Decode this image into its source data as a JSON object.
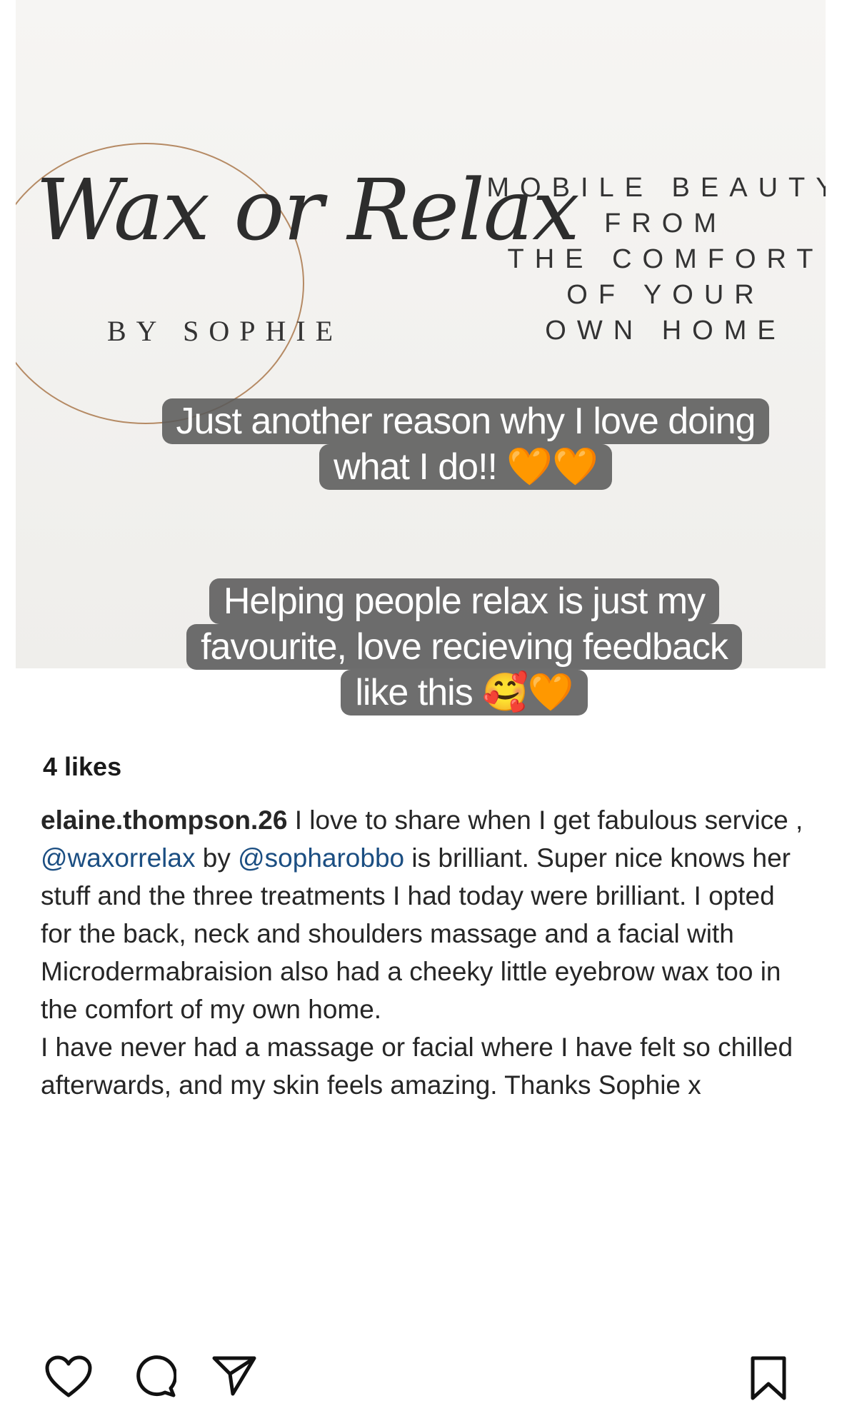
{
  "post_image": {
    "logo": {
      "script": "Wax or Relax",
      "by_line": "BY SOPHIE"
    },
    "tagline": "MOBILE BEAUTY\nFROM\nTHE COMFORT\nOF YOUR\nOWN HOME",
    "story_text_1": [
      "Just another reason why I love doing",
      "what I do!! 🧡🧡"
    ],
    "story_text_2": [
      "Helping people relax is just my",
      "favourite, love recieving feedback",
      "like this 🥰🧡"
    ]
  },
  "actions": {
    "like_icon": "heart-outline-icon",
    "comment_icon": "comment-bubble-icon",
    "share_icon": "paper-plane-icon",
    "save_icon": "bookmark-icon"
  },
  "likes": "4 likes",
  "caption": {
    "username": "elaine.thompson.26",
    "part1": " I love to share when I get fabulous service , ",
    "mention1": "@waxorrelax",
    "part2": " by ",
    "mention2": "@sopharobbo",
    "part3": " is brilliant. Super nice knows her stuff and the three treatments I had today were brilliant. I opted for the back, neck and shoulders massage and a facial with Microdermabraision also had a cheeky little eyebrow wax too in the comfort of my own home.",
    "part4": "I have never had a massage or facial where I have felt so chilled afterwards, and my skin feels amazing. Thanks Sophie x"
  },
  "colors": {
    "mention": "#1b4e82",
    "story_bg": "#5a5a5a",
    "logo_circle": "#b58a64"
  }
}
